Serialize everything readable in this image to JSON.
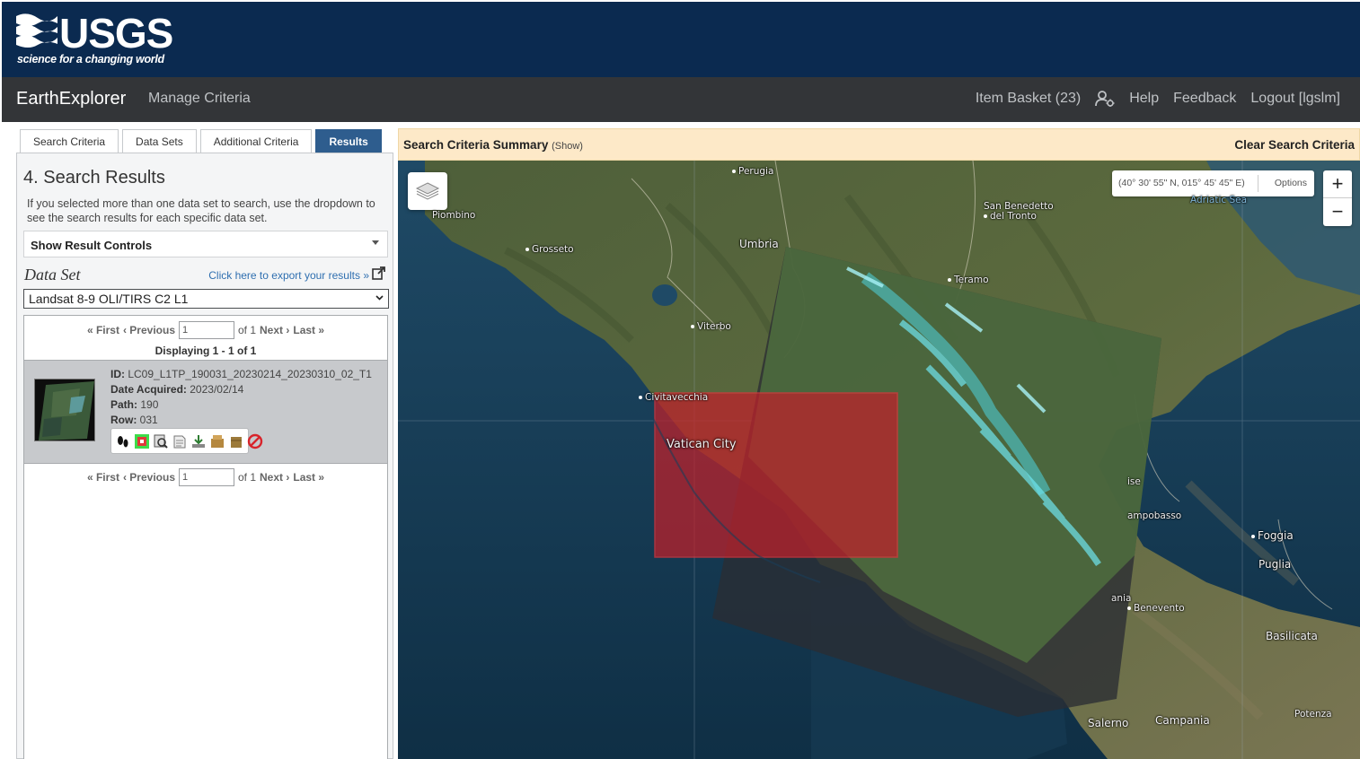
{
  "header": {
    "logo_word": "USGS",
    "logo_tagline": "science for a changing world",
    "app_title": "EarthExplorer",
    "manage_criteria": "Manage Criteria",
    "item_basket": "Item Basket (23)",
    "help": "Help",
    "feedback": "Feedback",
    "logout": "Logout [lgslm]"
  },
  "tabs": [
    {
      "label": "Search Criteria"
    },
    {
      "label": "Data Sets"
    },
    {
      "label": "Additional Criteria"
    },
    {
      "label": "Results",
      "active": true
    }
  ],
  "results_panel": {
    "title": "4. Search Results",
    "description": "If you selected more than one data set to search, use the dropdown to see the search results for each specific data set.",
    "show_result_controls": "Show Result Controls",
    "data_set_label": "Data Set",
    "export_link": "Click here to export your results »",
    "dataset_selected": "Landsat 8-9 OLI/TIRS C2 L1",
    "pager": {
      "first": "« First",
      "previous": "‹ Previous",
      "page_value": "1",
      "of_label": "of 1",
      "next": "Next ›",
      "last": "Last »"
    },
    "displaying": "Displaying 1 - 1 of 1",
    "result": {
      "id_label": "ID:",
      "id_value": "LC09_L1TP_190031_20230214_20230310_02_T1",
      "date_label": "Date Acquired:",
      "date_value": "2023/02/14",
      "path_label": "Path:",
      "path_value": "190",
      "row_label": "Row:",
      "row_value": "031"
    }
  },
  "map": {
    "summary_title": "Search Criteria Summary",
    "summary_show": "(Show)",
    "clear_criteria": "Clear Search Criteria",
    "coordinates": "(40° 30' 55\" N, 015° 45' 45\" E)",
    "options": "Options",
    "zoom_in": "+",
    "zoom_out": "−",
    "labels": {
      "perugia": "Perugia",
      "piombino": "Piombino",
      "grosseto": "Grosseto",
      "umbria": "Umbria",
      "san_benedetto_1": "San Benedetto",
      "san_benedetto_2": "del Tronto",
      "adriatic": "Adriatic Sea",
      "teramo": "Teramo",
      "viterbo": "Viterbo",
      "civitavecchia": "Civitavecchia",
      "vatican": "Vatican City",
      "ise": "ise",
      "campobasso": "ampobasso",
      "foggia": "Foggia",
      "puglia": "Puglia",
      "ania": "ania",
      "benevento": "Benevento",
      "basilicata": "Basilicata",
      "salerno": "Salerno",
      "campania": "Campania",
      "potenza": "Potenza"
    }
  },
  "colors": {
    "usgs_blue": "#0b2a50",
    "nav_dark": "#333538",
    "active_tab": "#2e5d8e",
    "summary_bar": "#fde9c8",
    "search_area_red": "#c0202a"
  }
}
